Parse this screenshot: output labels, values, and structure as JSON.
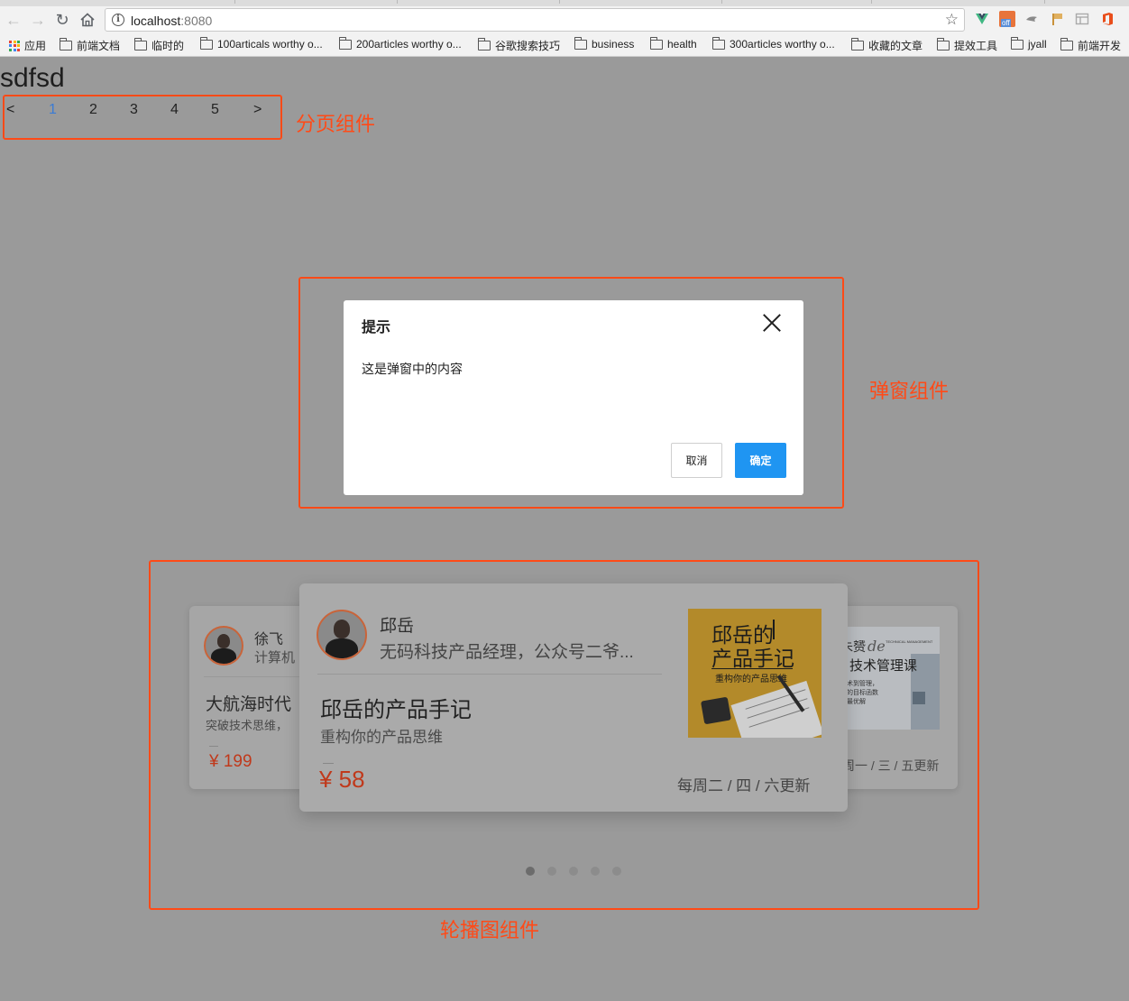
{
  "browser": {
    "url_host": "localhost",
    "url_port": ":8080",
    "bookmarks": [
      {
        "label": "应用",
        "icon": "apps-grid-icon"
      },
      {
        "label": "前端文档",
        "icon": "folder-icon"
      },
      {
        "label": "临时的",
        "icon": "folder-icon"
      },
      {
        "label": "100articals worthy o...",
        "icon": "folder-icon"
      },
      {
        "label": "200articles worthy o...",
        "icon": "folder-icon"
      },
      {
        "label": "谷歌搜索技巧",
        "icon": "folder-icon"
      },
      {
        "label": "business",
        "icon": "folder-icon"
      },
      {
        "label": "health",
        "icon": "folder-icon"
      },
      {
        "label": "300articles worthy o...",
        "icon": "folder-icon"
      },
      {
        "label": "收藏的文章",
        "icon": "folder-icon"
      },
      {
        "label": "提效工具",
        "icon": "folder-icon"
      },
      {
        "label": "jyall",
        "icon": "folder-icon"
      },
      {
        "label": "前端开发",
        "icon": "folder-icon"
      }
    ],
    "extension_badge": "off",
    "colors": {
      "chrome_bg": "#f2f2f2",
      "accent_orange": "#ff4a17"
    }
  },
  "page": {
    "title": "sdfsd"
  },
  "pagination": {
    "prev": "<",
    "pages": [
      "1",
      "2",
      "3",
      "4",
      "5"
    ],
    "active_page": "1",
    "next": ">",
    "annotation": "分页组件"
  },
  "modal": {
    "title": "提示",
    "body": "这是弹窗中的内容",
    "cancel_label": "取消",
    "ok_label": "确定",
    "annotation": "弹窗组件",
    "colors": {
      "ok_button": "#1f95f2"
    }
  },
  "carousel": {
    "annotation": "轮播图组件",
    "slide_count": 5,
    "active_index": 0,
    "cards": {
      "left": {
        "author": "徐飞",
        "author_title": "计算机",
        "course_title": "大航海时代",
        "course_subtitle": "突破技术思维，",
        "price": "¥ 199"
      },
      "center": {
        "author": "邱岳",
        "author_title": "无码科技产品经理，公众号二爷...",
        "course_title": "邱岳的产品手记",
        "course_subtitle": "重构你的产品思维",
        "price": "¥ 58",
        "schedule": "每周二 / 四 / 六更新",
        "cover_title_line1": "邱岳的",
        "cover_title_line2": "产品手记",
        "cover_subtitle": "重构你的产品思维"
      },
      "right": {
        "cover_text_brand": "朱赟",
        "cover_text_suffix": "de",
        "cover_text_tag": "TECHNICAL MANAGEMENT",
        "cover_title": "技术管理课",
        "cover_line1": "技术到管理，",
        "cover_line2": "你的目标函数",
        "cover_line3": "到最优解",
        "schedule": "周一 / 三 / 五更新"
      }
    }
  }
}
